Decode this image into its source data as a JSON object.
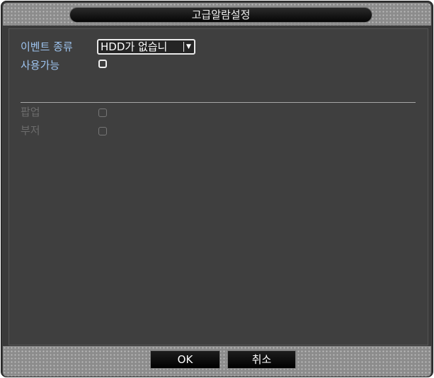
{
  "window": {
    "title": "고급알람설정"
  },
  "form": {
    "event_type_label": "이벤트 종류",
    "event_type_value": "HDD가 없습니",
    "enable_label": "사용가능",
    "popup_label": "팝업",
    "buzzer_label": "부저"
  },
  "buttons": {
    "ok": "OK",
    "cancel": "취소"
  },
  "colors": {
    "active_label": "#9dc3ee",
    "disabled_label": "#6c6c6c",
    "panel_bg": "#3f3f3f"
  },
  "icons": {
    "dropdown": "chevron-down-icon"
  }
}
